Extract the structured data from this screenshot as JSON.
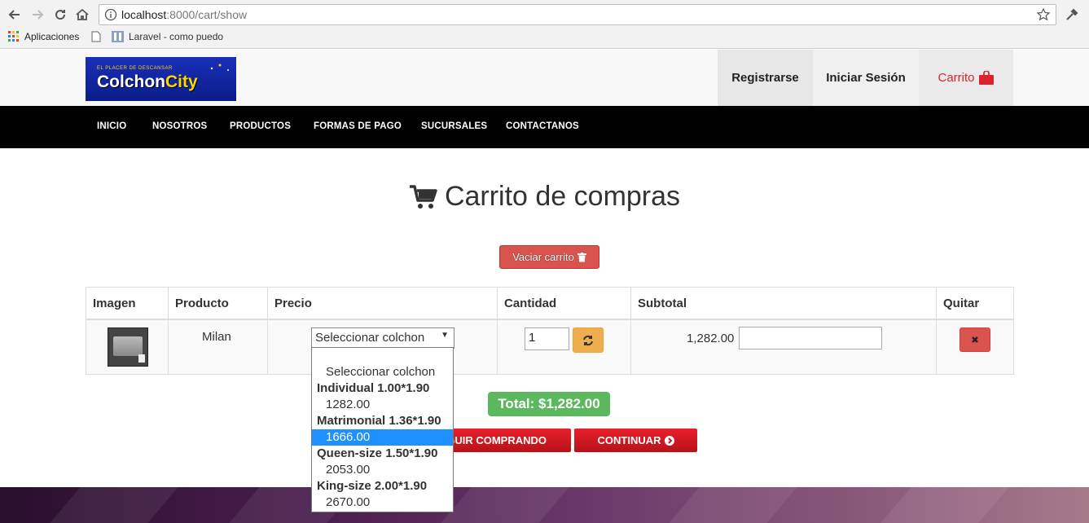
{
  "browser": {
    "url_host": "localhost",
    "url_path": ":8000/cart/show",
    "bookmarks": [
      {
        "label": "Aplicaciones"
      },
      {
        "label": "Laravel - como puedo"
      }
    ]
  },
  "header": {
    "logo_tagline": "EL PLACER DE DESCANSAR",
    "logo_word_a": "Colchon",
    "logo_word_b": "City",
    "register": "Registrarse",
    "login": "Iniciar Sesión",
    "cart": "Carrito"
  },
  "nav": {
    "items": [
      "INICIO",
      "NOSOTROS",
      "PRODUCTOS",
      "FORMAS DE PAGO",
      "SUCURSALES",
      "CONTACTANOS"
    ]
  },
  "page": {
    "title": "Carrito de compras",
    "empty_cart": "Vaciar carrito"
  },
  "table": {
    "headers": [
      "Imagen",
      "Producto",
      "Precio",
      "Cantidad",
      "Subtotal",
      "Quitar"
    ],
    "row": {
      "product": "Milan",
      "select_value": "Seleccionar colchon",
      "quantity": "1",
      "subtotal": "1,282.00"
    }
  },
  "dropdown": {
    "placeholder": "Seleccionar colchon",
    "groups": [
      {
        "label": "Individual 1.00*1.90",
        "price": "1282.00"
      },
      {
        "label": "Matrimonial 1.36*1.90",
        "price": "1666.00"
      },
      {
        "label": "Queen-size 1.50*1.90",
        "price": "2053.00"
      },
      {
        "label": "King-size 2.00*1.90",
        "price": "2670.00"
      }
    ],
    "selected_price": "1666.00"
  },
  "summary": {
    "total": "Total: $1,282.00",
    "keep_shopping": "GUIR COMPRANDO",
    "continue": "CONTINUAR"
  },
  "colors": {
    "brand_red": "#d9232d",
    "danger": "#d9534f",
    "success": "#5cb85c",
    "warning": "#f0ad4e",
    "nav_bg": "#000000"
  }
}
